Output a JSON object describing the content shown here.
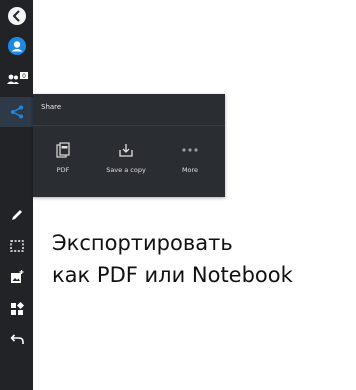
{
  "share_panel": {
    "title": "Share",
    "options": [
      {
        "label": "PDF",
        "icon": "pdf-file-icon"
      },
      {
        "label": "Save a copy",
        "icon": "download-tray-icon"
      },
      {
        "label": "More",
        "icon": "more-dots-icon"
      }
    ]
  },
  "sidebar": {
    "badge_count": "0",
    "tools": [
      "back-arrow-icon",
      "avatar-icon",
      "participants-icon",
      "share-icon",
      "pen-icon",
      "select-icon",
      "add-image-icon",
      "add-widget-icon",
      "undo-icon"
    ],
    "active_tool": "share-icon"
  },
  "caption": {
    "line1": "Экспортировать",
    "line2": "как PDF или Notebook"
  },
  "colors": {
    "toolbar_bg": "#212326",
    "panel_bg": "#2a2d31",
    "accent_blue": "#1e88e5"
  }
}
